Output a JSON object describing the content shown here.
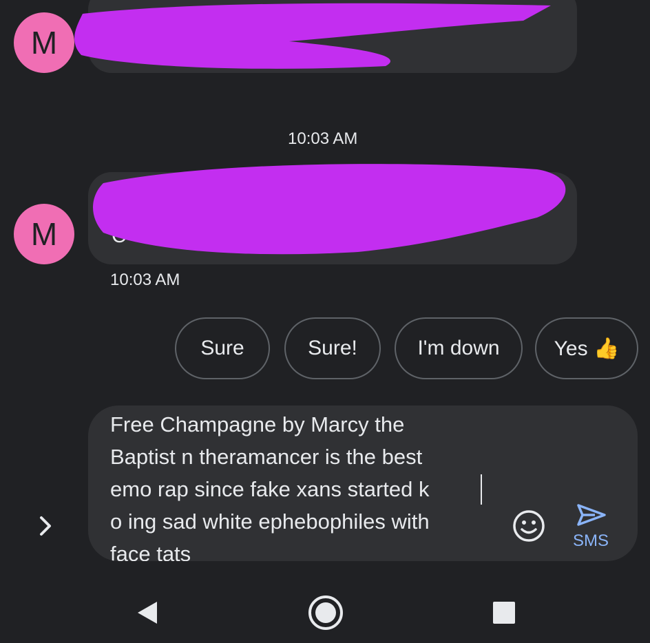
{
  "conversation": {
    "avatar_initial": "M",
    "timestamp_divider": "10:03 AM",
    "message_timestamp": "10:03 AM",
    "message_fragment": "C"
  },
  "smart_replies": [
    "Sure",
    "Sure!",
    "I'm down",
    "Yes 👍"
  ],
  "composer": {
    "text": "Free Champagne by Marcy the\nBaptist n theramancer is the best\nemo rap since fake xans started k\no ing sad white ephebophiles with\nface tats",
    "send_label": "SMS"
  },
  "icons": {
    "expand": "chevron-right-icon",
    "emoji": "emoji-icon",
    "send": "send-icon",
    "back": "back-triangle-icon",
    "home": "home-circle-icon",
    "recents": "recents-square-icon"
  },
  "colors": {
    "background": "#202124",
    "bubble": "#303134",
    "avatar": "#f06eb4",
    "redaction": "#c32ef0",
    "send_accent": "#8ab4f8"
  }
}
